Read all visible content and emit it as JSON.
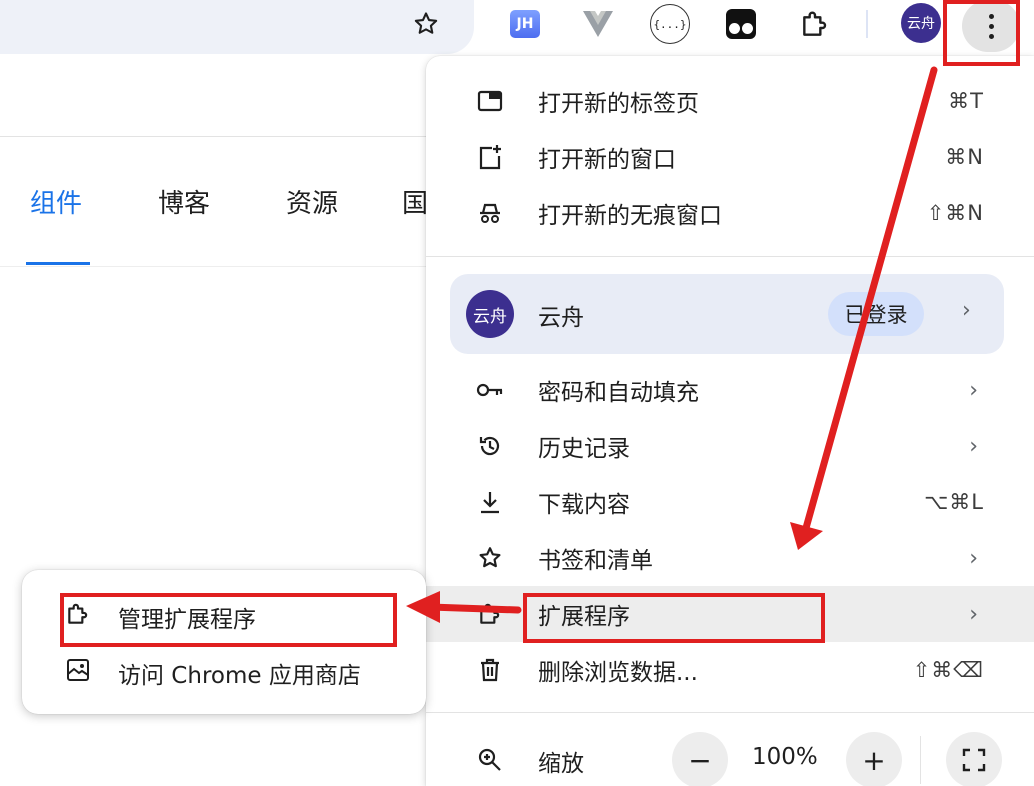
{
  "toolbar": {
    "avatar_text": "云舟",
    "json_ext_text": "{...}",
    "jh_ext_text": "JH",
    "icons": [
      "star-icon",
      "jh-extension-icon",
      "vue-devtools-icon",
      "json-viewer-icon",
      "tampermonkey-icon",
      "extensions-puzzle-icon",
      "more-vert-icon"
    ]
  },
  "page": {
    "nav": [
      "组件",
      "博客",
      "资源",
      "国"
    ],
    "active_nav": "组件",
    "accent": "#1a73e8"
  },
  "menu": {
    "new_tab": {
      "label": "打开新的标签页",
      "shortcut": "⌘T"
    },
    "new_window": {
      "label": "打开新的窗口",
      "shortcut": "⌘N"
    },
    "incognito": {
      "label": "打开新的无痕窗口",
      "shortcut": "⇧⌘N"
    },
    "profile": {
      "avatar": "云舟",
      "name": "云舟",
      "status": "已登录",
      "chevron": "›"
    },
    "passwords": {
      "label": "密码和自动填充",
      "chevron": "›"
    },
    "history": {
      "label": "历史记录",
      "chevron": "›"
    },
    "downloads": {
      "label": "下载内容",
      "shortcut": "⌥⌘L"
    },
    "bookmarks": {
      "label": "书签和清单",
      "chevron": "›"
    },
    "extensions": {
      "label": "扩展程序",
      "chevron": "›"
    },
    "clear_data": {
      "label": "删除浏览数据...",
      "shortcut": "⇧⌘⌫"
    },
    "zoom": {
      "label": "缩放",
      "minus": "−",
      "value": "100%",
      "plus": "+"
    }
  },
  "submenu": {
    "manage": {
      "label": "管理扩展程序"
    },
    "store": {
      "label": "访问 Chrome 应用商店"
    }
  },
  "annotation_color": "#e02020"
}
